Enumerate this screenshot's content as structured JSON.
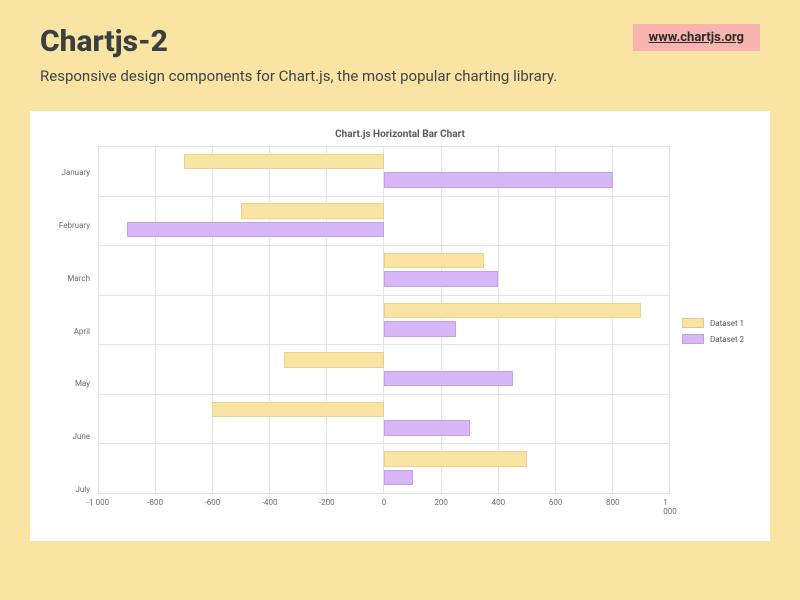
{
  "header": {
    "title": "Chartjs-2",
    "link_label": "www.chartjs.org",
    "subtitle": "Responsive design components for Chart.js, the most popular charting library."
  },
  "chart_data": {
    "type": "bar",
    "orientation": "horizontal",
    "title": "Chart.js Horizontal Bar Chart",
    "categories": [
      "January",
      "February",
      "March",
      "April",
      "May",
      "June",
      "July"
    ],
    "series": [
      {
        "name": "Dataset 1",
        "color": "#f9e4a3",
        "values": [
          -700,
          -500,
          350,
          900,
          -350,
          -600,
          500
        ]
      },
      {
        "name": "Dataset 2",
        "color": "#d7b6f5",
        "values": [
          800,
          -900,
          400,
          250,
          450,
          300,
          100
        ]
      }
    ],
    "xlabel": "",
    "ylabel": "",
    "xlim": [
      -1000,
      1000
    ],
    "xticks": [
      -1000,
      -800,
      -600,
      -400,
      -200,
      0,
      200,
      400,
      600,
      800,
      1000
    ],
    "xtick_labels": [
      "-1 000",
      "-800",
      "-600",
      "-400",
      "-200",
      "0",
      "200",
      "400",
      "600",
      "800",
      "1 000"
    ],
    "legend_position": "right",
    "grid": true
  }
}
